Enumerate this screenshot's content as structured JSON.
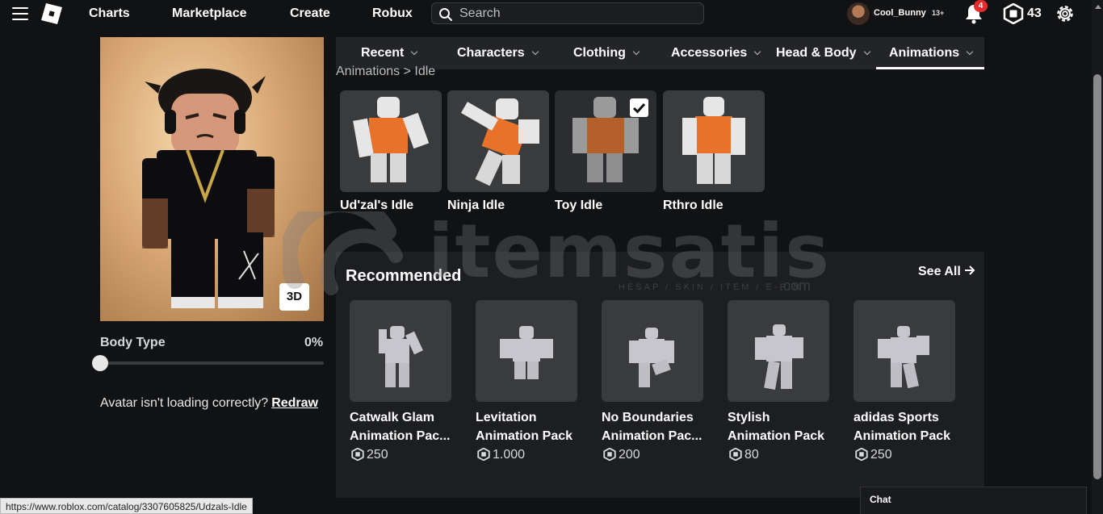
{
  "nav": {
    "links": [
      "Charts",
      "Marketplace",
      "Create",
      "Robux"
    ],
    "search_placeholder": "Search",
    "username": "Cool_Bunny",
    "age_tag": "13+",
    "notifications": "4",
    "robux": "43"
  },
  "avatar": {
    "btn_3d": "3D",
    "body_type_label": "Body Type",
    "body_type_value": "0%",
    "body_type_fraction": 0,
    "redraw_text": "Avatar isn't loading correctly?",
    "redraw_link": "Redraw"
  },
  "tabs": [
    {
      "label": "Recent",
      "active": false
    },
    {
      "label": "Characters",
      "active": false
    },
    {
      "label": "Clothing",
      "active": false
    },
    {
      "label": "Accessories",
      "active": false
    },
    {
      "label": "Head & Body",
      "active": false
    },
    {
      "label": "Animations",
      "active": true
    }
  ],
  "breadcrumb": "Animations > Idle",
  "items": [
    {
      "name": "Ud'zal's Idle",
      "selected": false
    },
    {
      "name": "Ninja Idle",
      "selected": false
    },
    {
      "name": "Toy Idle",
      "selected": true
    },
    {
      "name": "Rthro Idle",
      "selected": false
    }
  ],
  "recommended": {
    "title": "Recommended",
    "see_all": "See All",
    "items": [
      {
        "line1": "Catwalk Glam",
        "line2": "Animation Pac...",
        "price": "250"
      },
      {
        "line1": "Levitation",
        "line2": "Animation Pack",
        "price": "1.000"
      },
      {
        "line1": "No Boundaries",
        "line2": "Animation Pac...",
        "price": "200"
      },
      {
        "line1": "Stylish",
        "line2": "Animation Pack",
        "price": "80"
      },
      {
        "line1": "adidas Sports",
        "line2": "Animation Pack",
        "price": "250"
      }
    ]
  },
  "watermark": {
    "brand": "itemsatis",
    "sub": "HESAP / SKIN / ITEM / E-PIN",
    "suffix": ".com"
  },
  "status_url": "https://www.roblox.com/catalog/3307605825/Udzals-Idle",
  "chat_label": "Chat",
  "colors": {
    "background": "#111214",
    "panel": "#1d1e22",
    "tile": "#393b3d",
    "badge": "#e52b2b"
  }
}
